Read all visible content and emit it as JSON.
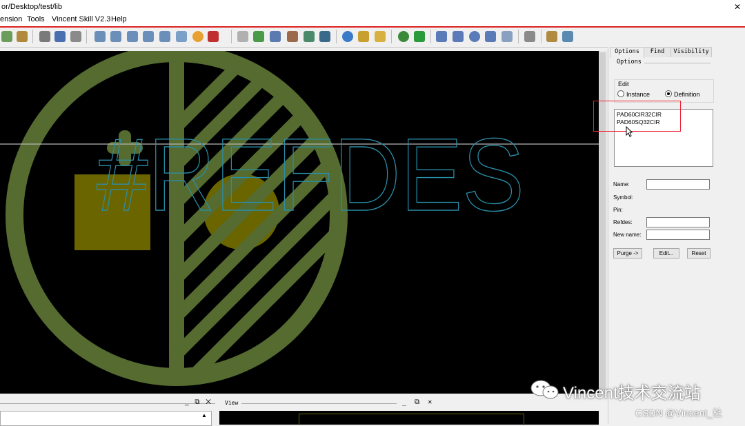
{
  "titlebar": {
    "path": "or/Desktop/test/lib",
    "close": "✕"
  },
  "menu": [
    "ension",
    "Tools",
    "Vincent Skill V2.3",
    "Help"
  ],
  "panel": {
    "tabs": [
      "Options",
      "Find",
      "Visibility"
    ],
    "section_title": "Options",
    "edit_group": "Edit",
    "radio_instance": "Instance",
    "radio_definition": "Definition",
    "selected_radio": "Definition",
    "list_items": [
      "PAD60CIR32CIR",
      "PAD60SQ32CIR"
    ],
    "label_name": "Name:",
    "label_symbol": "Symbol:",
    "label_pin": "Pin:",
    "label_refdes": "Refdes:",
    "label_newname": "New name:",
    "btn_purge": "Purge ->",
    "btn_edit": "Edit...",
    "btn_reset": "Reset"
  },
  "canvas": {
    "refdes_text": "#REFDES"
  },
  "bottom": {
    "view_title": "View",
    "win_controls": "_ ⧉ ✕",
    "scroll_up": "▲"
  },
  "watermark": {
    "text": "Vincent技术交流站",
    "csdn": "CSDN @Vincent_杜"
  },
  "colors": {
    "pad_green": "#556b2f",
    "pad_yellow": "#6b6500",
    "text_cyan": "#2a8ea8",
    "highlight_red": "#e22"
  }
}
